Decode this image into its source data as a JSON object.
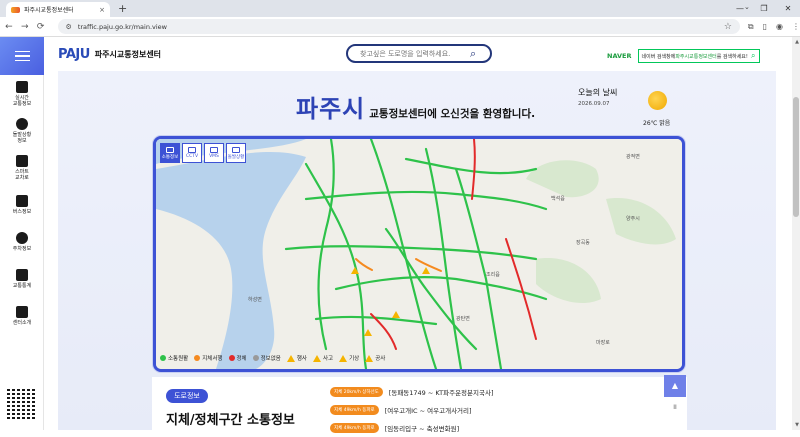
{
  "browser": {
    "tab_title": "파주시교통정보센터",
    "tab_close": "×",
    "new_tab": "+",
    "url": "traffic.paju.go.kr/main.view",
    "dropdown": "⌄",
    "controls": [
      "—",
      "❐",
      "✕"
    ],
    "nav": [
      "←",
      "→",
      "⟳"
    ]
  },
  "sidebar": {
    "items": [
      {
        "label": "실시간\n교통정보",
        "icon": "traffic-light-icon"
      },
      {
        "label": "돌발상황\n정보",
        "icon": "alert-icon"
      },
      {
        "label": "스마트\n교차로",
        "icon": "smart-crossroad-icon"
      },
      {
        "label": "버스정보",
        "icon": "bus-icon"
      },
      {
        "label": "주차정보",
        "icon": "parking-icon"
      },
      {
        "label": "교통통계",
        "icon": "chart-icon"
      },
      {
        "label": "센터소개",
        "icon": "building-icon"
      }
    ]
  },
  "header": {
    "logo_mark": "PAJU",
    "logo_name": "파주시교통정보센터",
    "search_placeholder": "찾고싶은 도로명을 입력하세요.",
    "naver_logo": "NAVER",
    "naver_text_pre": "네이버 검색창에 ",
    "naver_text_hl": "파주시교통정보센터",
    "naver_text_post": "를 검색하세요!"
  },
  "welcome": {
    "city": "파주시",
    "message": "교통정보센터에 오신것을 환영합니다."
  },
  "weather": {
    "title": "오늘의 날씨",
    "date": "2026.09.07",
    "temp": "26℃ 맑음"
  },
  "map": {
    "tabs": [
      "소통정보",
      "CCTV",
      "VMS",
      "돌발상황"
    ],
    "labels": [
      "광적면",
      "백석읍",
      "양주시",
      "하성면",
      "조리읍",
      "장곡동",
      "광탄면",
      "마장로"
    ],
    "legend": [
      {
        "label": "소통원활",
        "color": "#2ec24a",
        "shape": "dot"
      },
      {
        "label": "지체서행",
        "color": "#f58a1f",
        "shape": "dot"
      },
      {
        "label": "정체",
        "color": "#e22a2a",
        "shape": "dot"
      },
      {
        "label": "정보없음",
        "color": "#9a9a9a",
        "shape": "dot"
      },
      {
        "label": "행사",
        "color": "#f5b400",
        "shape": "tri"
      },
      {
        "label": "사고",
        "color": "#f5b400",
        "shape": "tri"
      },
      {
        "label": "기상",
        "color": "#f5b400",
        "shape": "tri"
      },
      {
        "label": "공사",
        "color": "#f5b400",
        "shape": "tri"
      }
    ]
  },
  "road_info": {
    "badge": "도로정보",
    "title": "지체/정체구간 소통정보",
    "rows": [
      {
        "tag": "지체 20km/h 상하선도",
        "name": "[동패동1749 ~ KT파주운정분지국사]"
      },
      {
        "tag": "지체 49km/h 동파로",
        "name": "[여우고개IC ~ 여우고개사거리]"
      },
      {
        "tag": "지체 49km/h 동파로",
        "name": "[임동리입구 ~ 축성변화원]"
      }
    ],
    "up": "▲",
    "pause": "II"
  }
}
